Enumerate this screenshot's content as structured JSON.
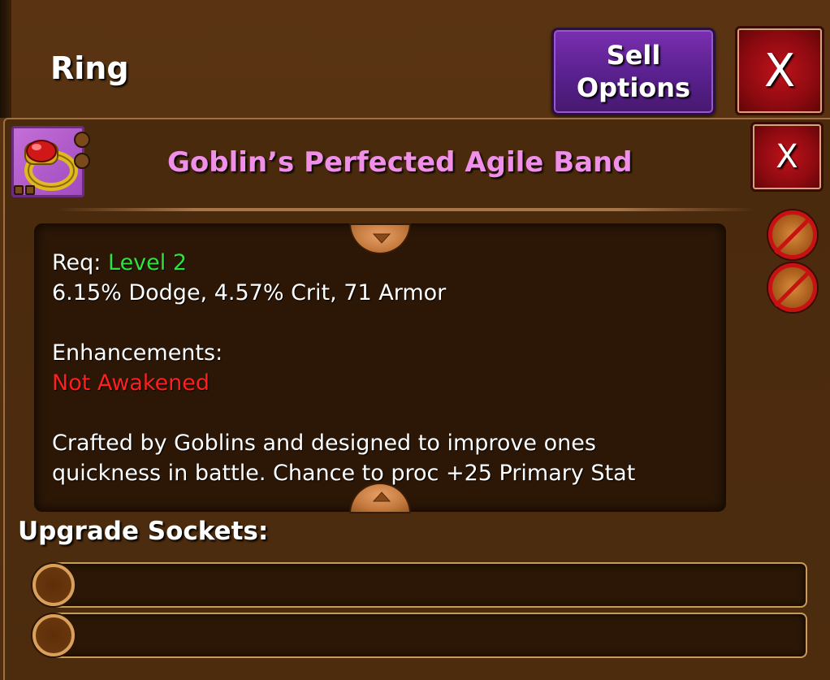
{
  "header": {
    "category_title": "Ring",
    "sell_button_line1": "Sell",
    "sell_button_line2": "Options",
    "close_label": "X"
  },
  "item": {
    "name": "Goblin’s Perfected Agile Band",
    "name_color": "#f08fe8",
    "icon": "ring-icon",
    "close_label": "X",
    "req_label": "Req:",
    "req_value": "Level 2",
    "stats": "6.15% Dodge, 4.57% Crit, 71 Armor",
    "enhancements_label": "Enhancements:",
    "enhancements_value": "Not Awakened",
    "description_line1": "Crafted by Goblins and designed to improve ones",
    "description_line2": "quickness in battle. Chance to proc +25 Primary Stat"
  },
  "side_icons": [
    "no-trade-icon",
    "no-sell-icon"
  ],
  "sockets": {
    "label": "Upgrade Sockets:",
    "slots": [
      {
        "state": "empty"
      },
      {
        "state": "empty"
      }
    ]
  },
  "colors": {
    "background": "#4e2c0f",
    "sell_button": "#561f8a",
    "close_button": "#8c0a10",
    "requirement_ok": "#31e23e",
    "warning": "#ff1f1f"
  }
}
